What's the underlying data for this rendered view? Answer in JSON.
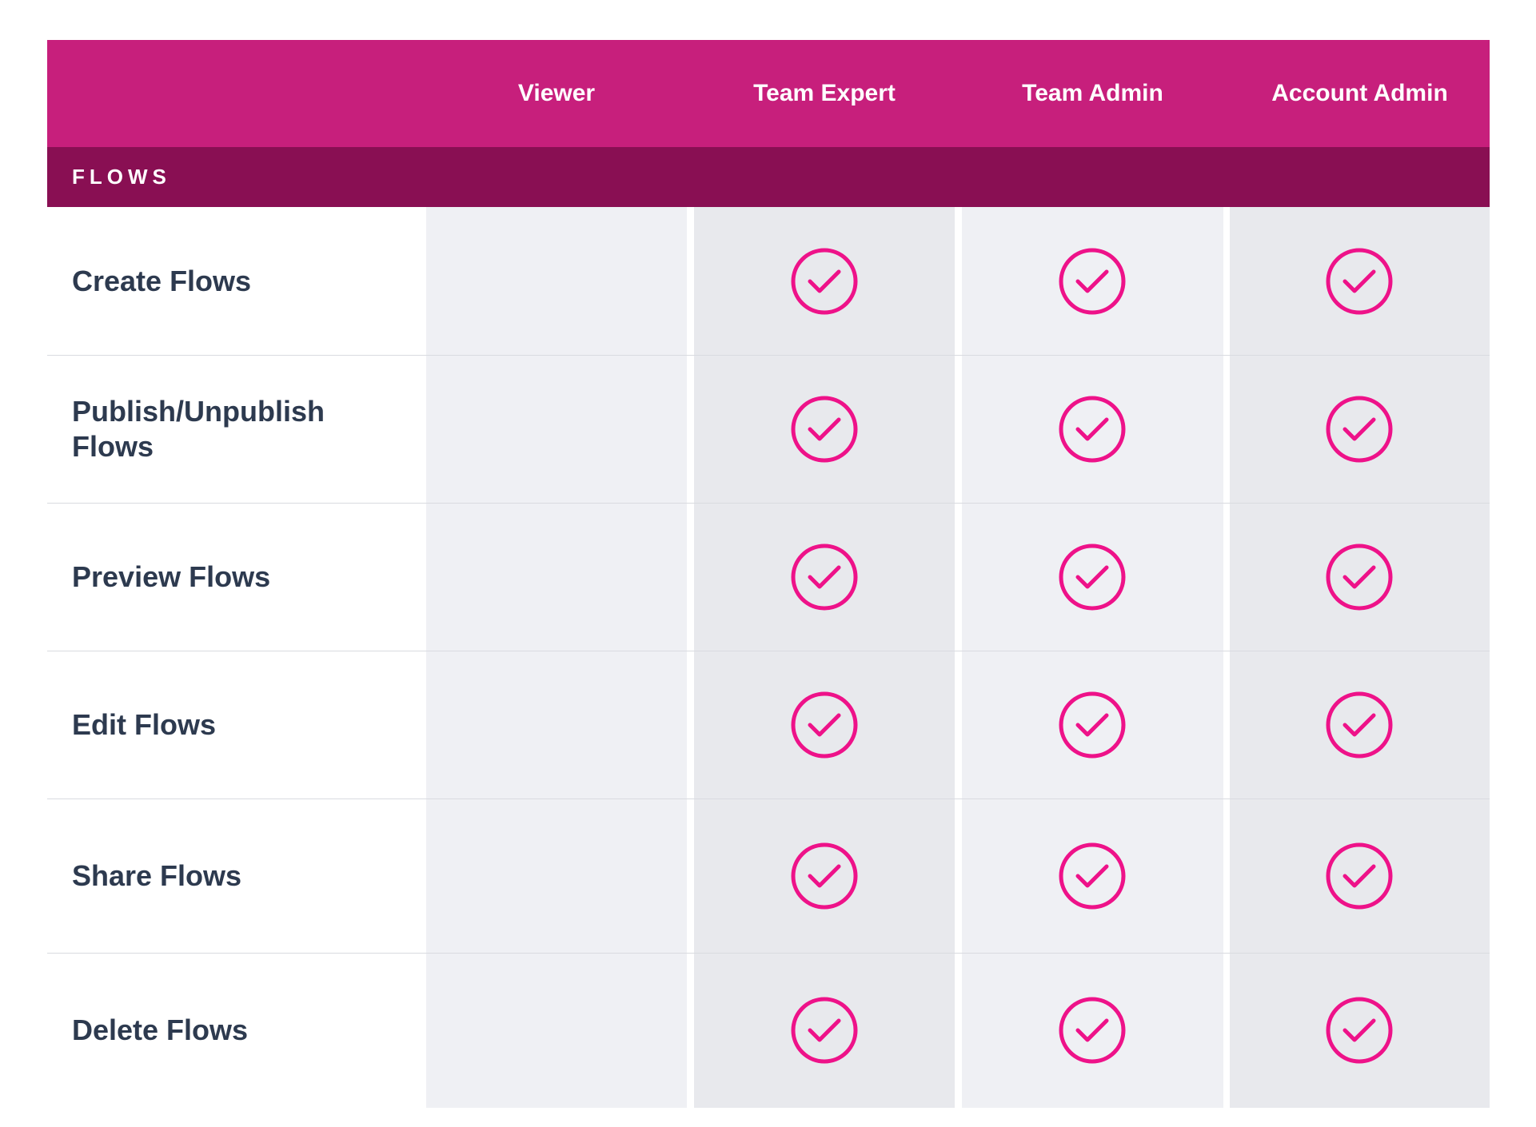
{
  "columns": [
    "Viewer",
    "Team Expert",
    "Team Admin",
    "Account Admin"
  ],
  "section": "FLOWS",
  "rows": [
    {
      "label": "Create Flows",
      "permissions": [
        false,
        true,
        true,
        true
      ]
    },
    {
      "label": "Publish/Unpublish Flows",
      "permissions": [
        false,
        true,
        true,
        true
      ]
    },
    {
      "label": "Preview Flows",
      "permissions": [
        false,
        true,
        true,
        true
      ]
    },
    {
      "label": "Edit Flows",
      "permissions": [
        false,
        true,
        true,
        true
      ]
    },
    {
      "label": "Share Flows",
      "permissions": [
        false,
        true,
        true,
        true
      ]
    },
    {
      "label": "Delete Flows",
      "permissions": [
        false,
        true,
        true,
        true
      ]
    }
  ],
  "icons": {
    "granted": "check-circle-icon"
  },
  "colors": {
    "header": "#c71f7c",
    "section": "#890f53",
    "check": "#ee1289",
    "text": "#2d3a4f"
  }
}
